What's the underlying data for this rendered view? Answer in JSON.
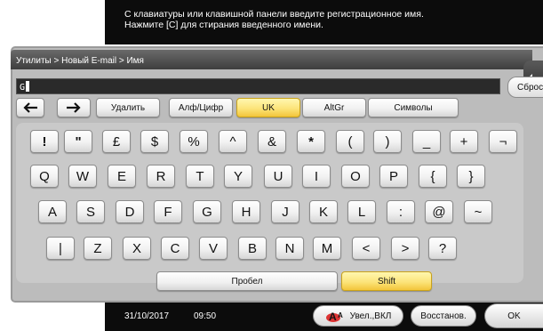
{
  "message": {
    "line1": "С клавиатуры или клавишной панели введите регистрационное имя.",
    "line2": "Нажмите [С] для стирания введенного имени."
  },
  "breadcrumb": "Утилиты > Новый E-mail > Имя",
  "input": {
    "value": "G"
  },
  "buttons": {
    "reset": "Сброс",
    "back_arrow_icon": "arrow-left-icon",
    "forward_arrow_icon": "arrow-right-icon",
    "delete": "Удалить",
    "alphanumeric": "Алф/Цифр",
    "uk": "UK",
    "altgr": "AltGr",
    "symbols": "Символы",
    "space": "Пробел",
    "shift": "Shift"
  },
  "keyboard": {
    "row1": [
      "!",
      "\"",
      "£",
      "$",
      "%",
      "^",
      "&",
      "*",
      "(",
      ")",
      "_",
      "+",
      "¬"
    ],
    "row2": [
      "Q",
      "W",
      "E",
      "R",
      "T",
      "Y",
      "U",
      "I",
      "O",
      "P",
      "{",
      "}"
    ],
    "row3": [
      "A",
      "S",
      "D",
      "F",
      "G",
      "H",
      "J",
      "K",
      "L",
      ":",
      "@",
      "~"
    ],
    "row4": [
      "|",
      "Z",
      "X",
      "C",
      "V",
      "B",
      "N",
      "M",
      "<",
      ">",
      "?"
    ]
  },
  "status": {
    "date": "31/10/2017",
    "time": "09:50",
    "zoom": "Увел.,ВКЛ",
    "restore": "Восстанов.",
    "ok": "OK"
  },
  "colors": {
    "active_key": "#f7d556",
    "panel_bg": "#bcbcbc",
    "top_bar": "#0c0c0c"
  }
}
